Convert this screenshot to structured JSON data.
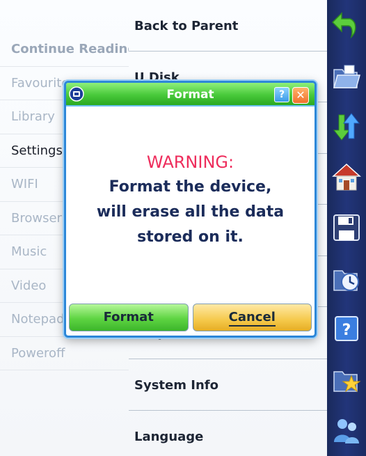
{
  "left_menu": {
    "items": [
      {
        "label": "Continue Reading"
      },
      {
        "label": "Favourite"
      },
      {
        "label": "Library"
      },
      {
        "label": "Settings"
      },
      {
        "label": "WIFI"
      },
      {
        "label": "Browser"
      },
      {
        "label": "Music"
      },
      {
        "label": "Video"
      },
      {
        "label": "Notepad"
      },
      {
        "label": "Poweroff"
      }
    ],
    "active": "Settings"
  },
  "settings_list": {
    "items": [
      {
        "label": "Back to Parent"
      },
      {
        "label": "U Disk"
      },
      {
        "label": ""
      },
      {
        "label": ""
      },
      {
        "label": ""
      },
      {
        "label": ""
      },
      {
        "label": "Help"
      },
      {
        "label": "System Info"
      },
      {
        "label": "Language"
      }
    ]
  },
  "icon_bar": {
    "icons": [
      "back-arrow-icon",
      "folder-icon",
      "up-down-arrows-icon",
      "home-icon",
      "floppy-disk-icon",
      "clock-folder-icon",
      "help-icon",
      "favorite-folder-icon",
      "users-icon"
    ]
  },
  "dialog": {
    "title": "Format",
    "help_glyph": "?",
    "close_glyph": "✕",
    "warning": "WARNING:",
    "message_lines": [
      "Format the device,",
      "will erase all the data",
      "stored on it."
    ],
    "format_button": "Format",
    "cancel_button": "Cancel"
  }
}
